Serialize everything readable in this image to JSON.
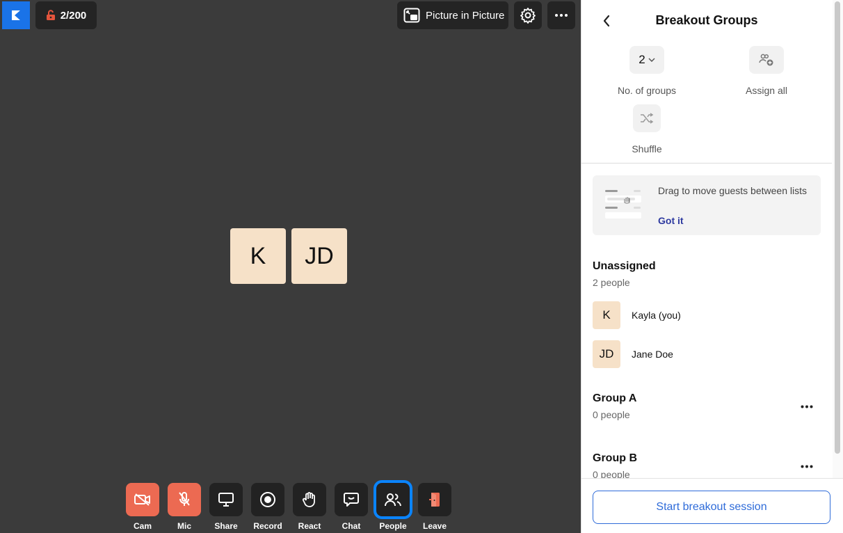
{
  "meeting": {
    "participant_count": "2/200",
    "pip_label": "Picture in Picture",
    "tiles": [
      "K",
      "JD"
    ]
  },
  "toolbar": {
    "items": [
      {
        "label": "Cam",
        "icon": "camera-off-icon",
        "style": "red"
      },
      {
        "label": "Mic",
        "icon": "mic-off-icon",
        "style": "red"
      },
      {
        "label": "Share",
        "icon": "screen-share-icon",
        "style": "dark"
      },
      {
        "label": "Record",
        "icon": "record-icon",
        "style": "dark"
      },
      {
        "label": "React",
        "icon": "hand-icon",
        "style": "dark"
      },
      {
        "label": "Chat",
        "icon": "chat-icon",
        "style": "dark"
      },
      {
        "label": "People",
        "icon": "people-icon",
        "style": "active"
      },
      {
        "label": "Leave",
        "icon": "leave-icon",
        "style": "dark"
      }
    ]
  },
  "panel": {
    "title": "Breakout Groups",
    "groups_count_value": "2",
    "groups_count_label": "No. of groups",
    "assign_all_label": "Assign all",
    "shuffle_label": "Shuffle",
    "tip_text": "Drag to move guests between lists",
    "tip_link": "Got it",
    "unassigned": {
      "title": "Unassigned",
      "count": "2 people",
      "people": [
        {
          "initials": "K",
          "name": "Kayla (you)"
        },
        {
          "initials": "JD",
          "name": "Jane Doe"
        }
      ]
    },
    "groups": [
      {
        "title": "Group A",
        "count": "0 people"
      },
      {
        "title": "Group B",
        "count": "0 people"
      }
    ],
    "start_button": "Start breakout session"
  },
  "colors": {
    "stage_bg": "#3b3b3b",
    "accent_blue": "#0a84ff",
    "danger": "#ec6a52",
    "avatar_bg": "#f6e1c8",
    "link": "#2e3aa0"
  }
}
